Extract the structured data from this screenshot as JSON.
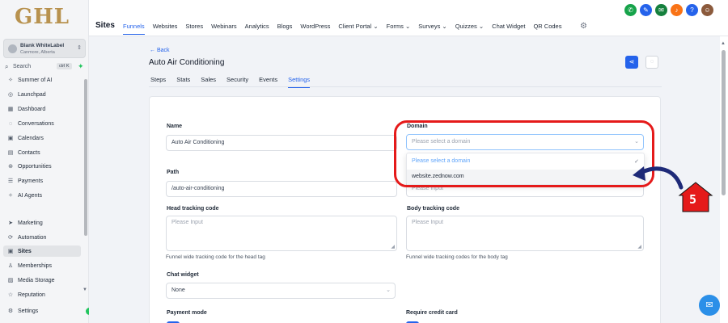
{
  "sidebar": {
    "logo": "GHL",
    "account_name": "Blank WhiteLabel",
    "account_location": "Canmore, Alberta",
    "search_label": "Search",
    "search_shortcut": "ctrl K",
    "items": [
      {
        "label": "Summer of AI",
        "icon": "sparkle-icon"
      },
      {
        "label": "Launchpad",
        "icon": "rocket-icon"
      },
      {
        "label": "Dashboard",
        "icon": "grid-icon"
      },
      {
        "label": "Conversations",
        "icon": "chat-icon"
      },
      {
        "label": "Calendars",
        "icon": "calendar-icon"
      },
      {
        "label": "Contacts",
        "icon": "contacts-icon"
      },
      {
        "label": "Opportunities",
        "icon": "target-icon"
      },
      {
        "label": "Payments",
        "icon": "payments-icon"
      },
      {
        "label": "AI Agents",
        "icon": "ai-icon"
      },
      {
        "label": "Marketing",
        "icon": "send-icon"
      },
      {
        "label": "Automation",
        "icon": "automation-icon"
      },
      {
        "label": "Sites",
        "icon": "sites-icon"
      },
      {
        "label": "Memberships",
        "icon": "membership-icon"
      },
      {
        "label": "Media Storage",
        "icon": "image-icon"
      },
      {
        "label": "Reputation",
        "icon": "star-icon"
      },
      {
        "label": "Settings",
        "icon": "gear-icon"
      }
    ],
    "active_item": "Sites"
  },
  "topbar": {
    "section_title": "Sites",
    "nav": [
      "Funnels",
      "Websites",
      "Stores",
      "Webinars",
      "Analytics",
      "Blogs",
      "WordPress",
      "Client Portal ⌄",
      "Forms ⌄",
      "Surveys ⌄",
      "Quizzes ⌄",
      "Chat Widget",
      "QR Codes"
    ],
    "active_nav": "Funnels",
    "icons": [
      {
        "name": "phone-icon",
        "color": "#16a34a",
        "glyph": "✆"
      },
      {
        "name": "pen-icon",
        "color": "#2563eb",
        "glyph": "✎"
      },
      {
        "name": "megaphone-icon",
        "color": "#15803d",
        "glyph": "✉"
      },
      {
        "name": "bell-icon",
        "color": "#f97316",
        "glyph": "♪"
      },
      {
        "name": "help-icon",
        "color": "#2563eb",
        "glyph": "?"
      }
    ]
  },
  "page": {
    "back_label": "← Back",
    "title": "Auto Air Conditioning",
    "tabs": [
      "Steps",
      "Stats",
      "Sales",
      "Security",
      "Events",
      "Settings"
    ],
    "active_tab": "Settings"
  },
  "form": {
    "name_label": "Name",
    "name_value": "Auto Air Conditioning",
    "domain_label": "Domain",
    "domain_placeholder": "Please select a domain",
    "domain_options": [
      "Please select a domain",
      "website.zednow.com"
    ],
    "path_label": "Path",
    "path_value": "/auto-air-conditioning",
    "right_row2_placeholder": "Please Input",
    "head_label": "Head tracking code",
    "head_placeholder": "Please Input",
    "head_hint": "Funnel wide tracking code for the head tag",
    "body_label": "Body tracking code",
    "body_placeholder": "Please Input",
    "body_hint": "Funnel wide tracking codes for the body tag",
    "chat_label": "Chat widget",
    "chat_value": "None",
    "payment_label": "Payment mode",
    "credit_label": "Require credit card"
  },
  "annotation": {
    "step_number": "5",
    "color": "#e51a1a"
  },
  "colors": {
    "accent": "#2563eb",
    "brand_gold": "#b8924f",
    "annotation_red": "#e51a1a"
  }
}
